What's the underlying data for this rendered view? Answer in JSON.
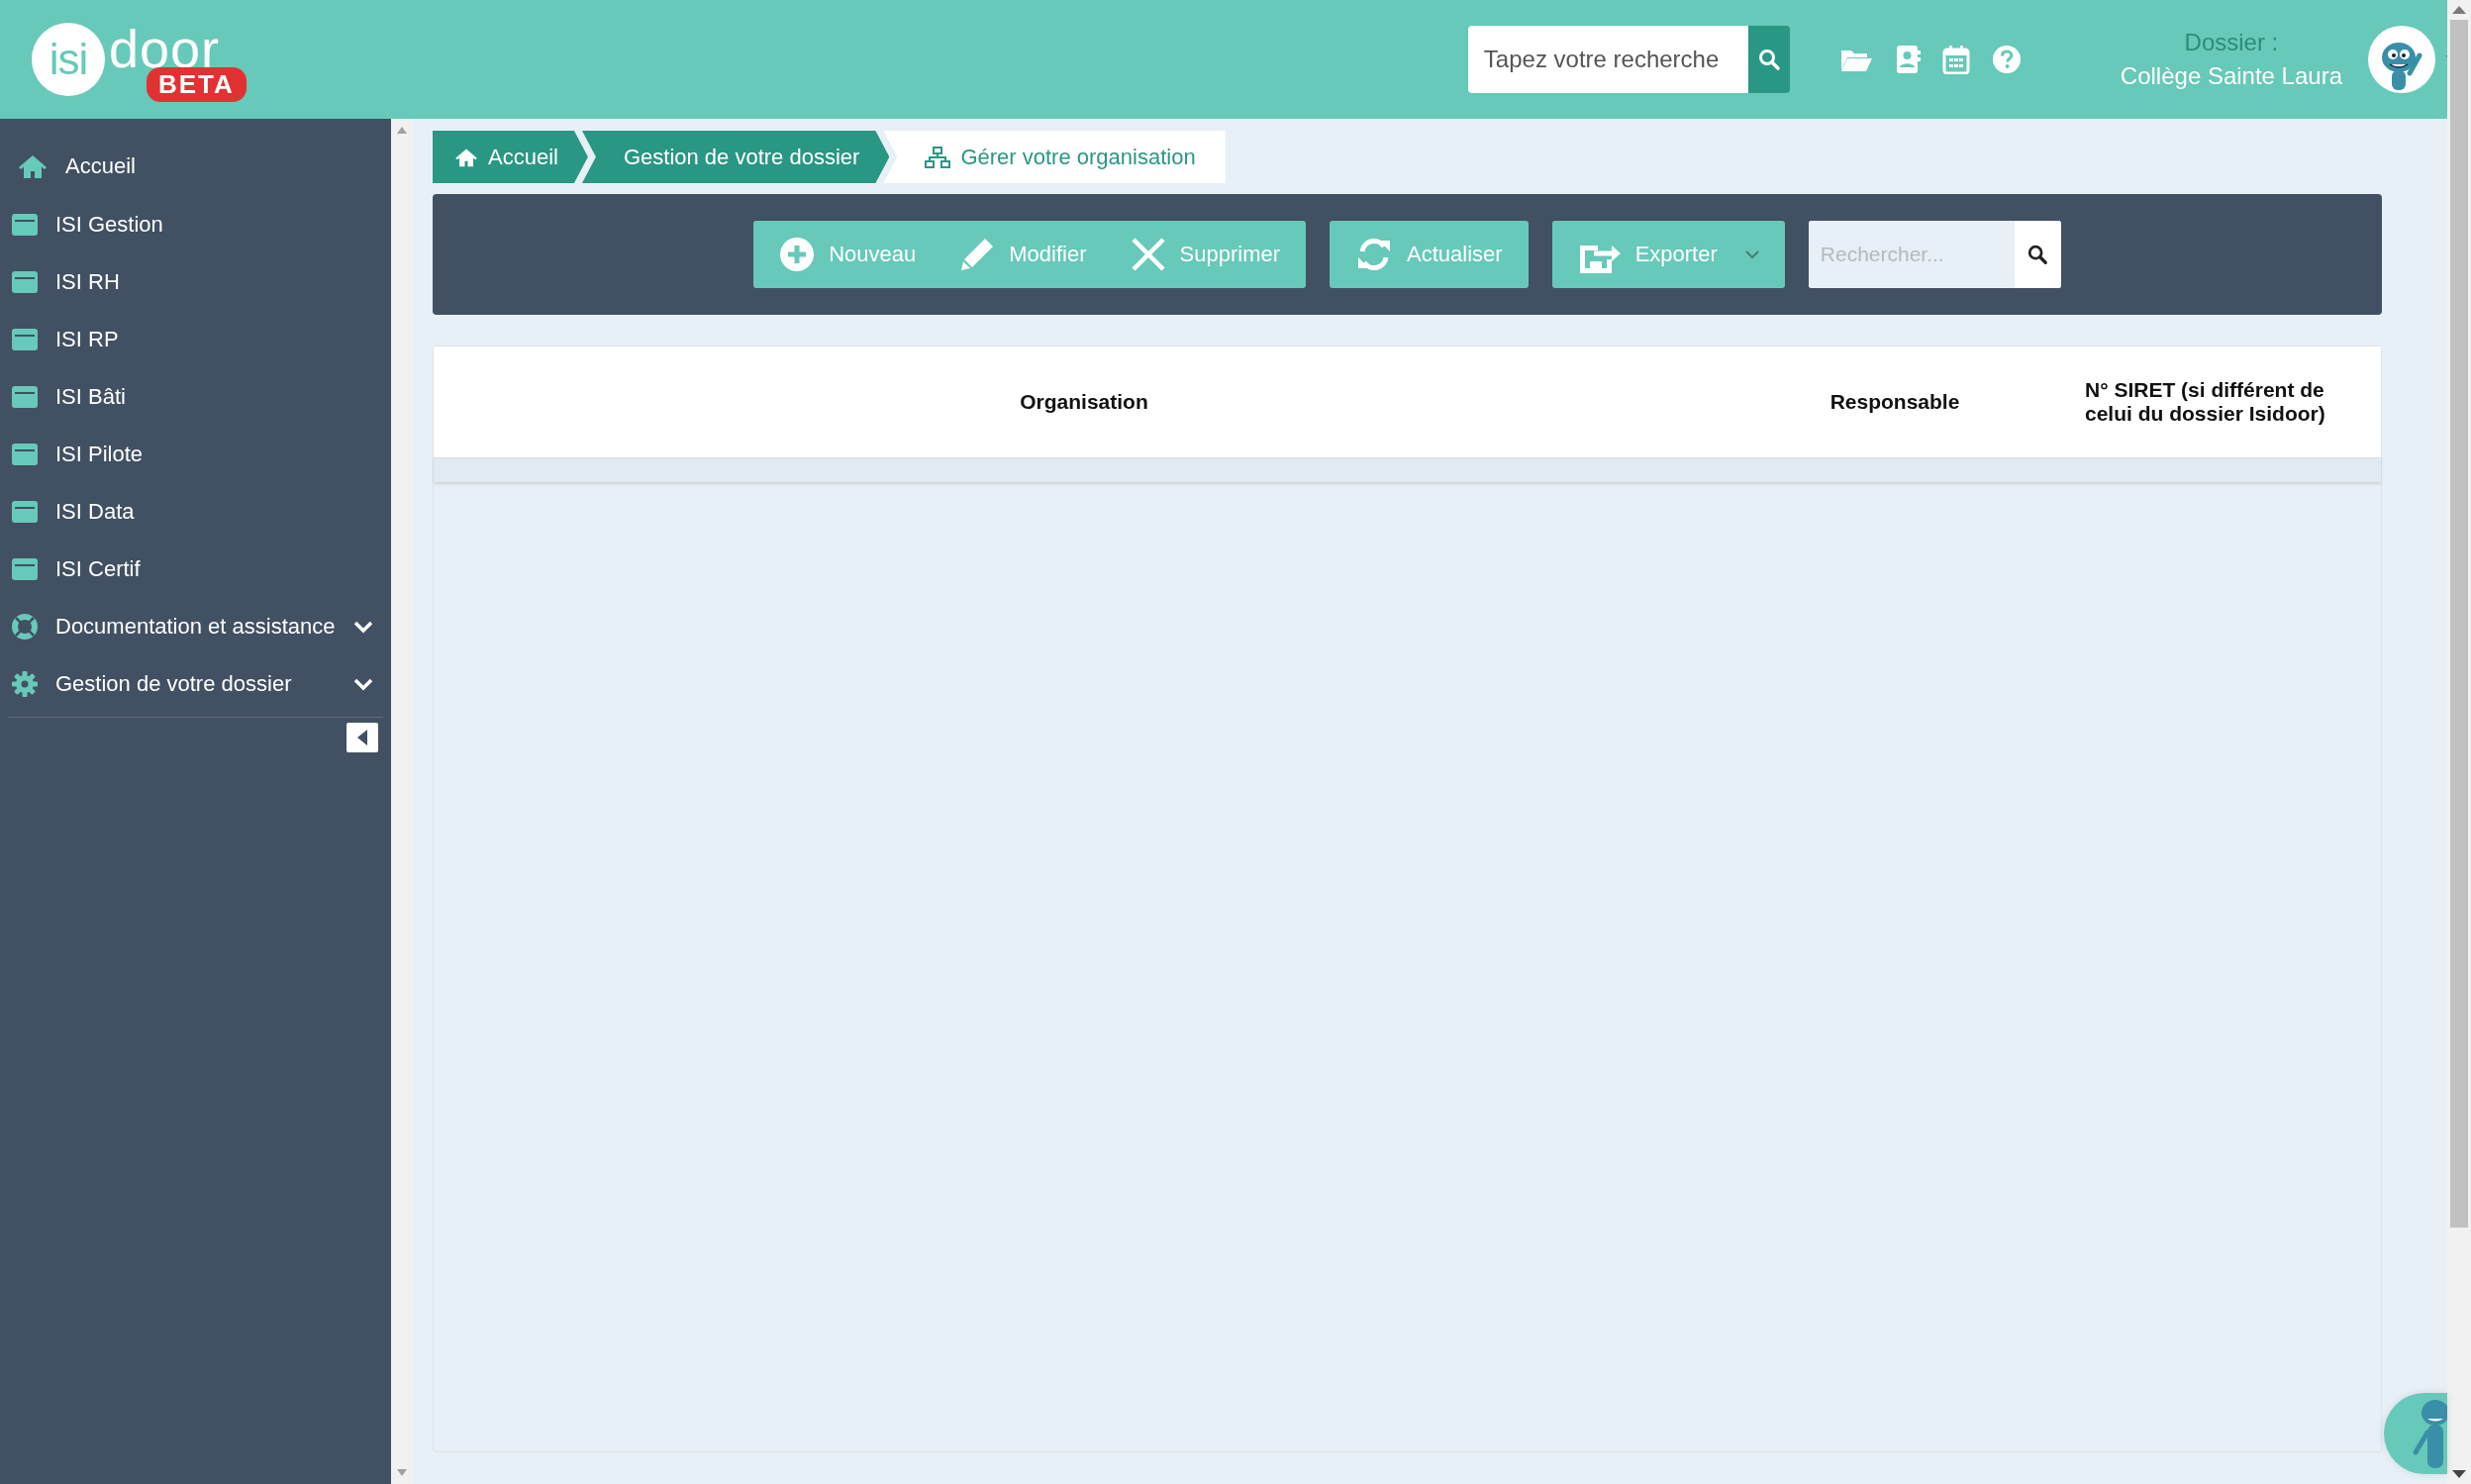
{
  "logo": {
    "first": "isi",
    "second": "door",
    "badge": "BETA"
  },
  "header": {
    "search": {
      "placeholder": "Tapez votre recherche"
    },
    "dossier_label": "Dossier :",
    "dossier_name": "Collège Sainte Laura"
  },
  "sidebar": {
    "items": [
      {
        "label": "Accueil",
        "kind": "home"
      },
      {
        "label": "ISI Gestion",
        "kind": "module"
      },
      {
        "label": "ISI RH",
        "kind": "module"
      },
      {
        "label": "ISI RP",
        "kind": "module"
      },
      {
        "label": "ISI Bâti",
        "kind": "module"
      },
      {
        "label": "ISI Pilote",
        "kind": "module"
      },
      {
        "label": "ISI Data",
        "kind": "module"
      },
      {
        "label": "ISI Certif",
        "kind": "module"
      },
      {
        "label": "Documentation et assistance",
        "kind": "help",
        "expanded": false
      },
      {
        "label": "Gestion de votre dossier",
        "kind": "settings",
        "expanded": false
      }
    ]
  },
  "breadcrumbs": [
    {
      "label": "Accueil",
      "kind": "home"
    },
    {
      "label": "Gestion de votre dossier",
      "kind": "plain"
    },
    {
      "label": "Gérer votre organisation",
      "kind": "current"
    }
  ],
  "toolbar": {
    "groups": [
      {
        "buttons": [
          {
            "label": "Nouveau",
            "kind": "new"
          },
          {
            "label": "Modifier",
            "kind": "edit"
          },
          {
            "label": "Supprimer",
            "kind": "delete"
          }
        ]
      },
      {
        "buttons": [
          {
            "label": "Actualiser",
            "kind": "refresh"
          }
        ]
      },
      {
        "buttons": [
          {
            "label": "Exporter",
            "kind": "export"
          }
        ]
      }
    ],
    "search": {
      "placeholder": "Rechercher..."
    }
  },
  "table": {
    "columns": [
      "Organisation",
      "Responsable",
      "N° SIRET (si différent de celui du dossier Isidoor)"
    ]
  }
}
